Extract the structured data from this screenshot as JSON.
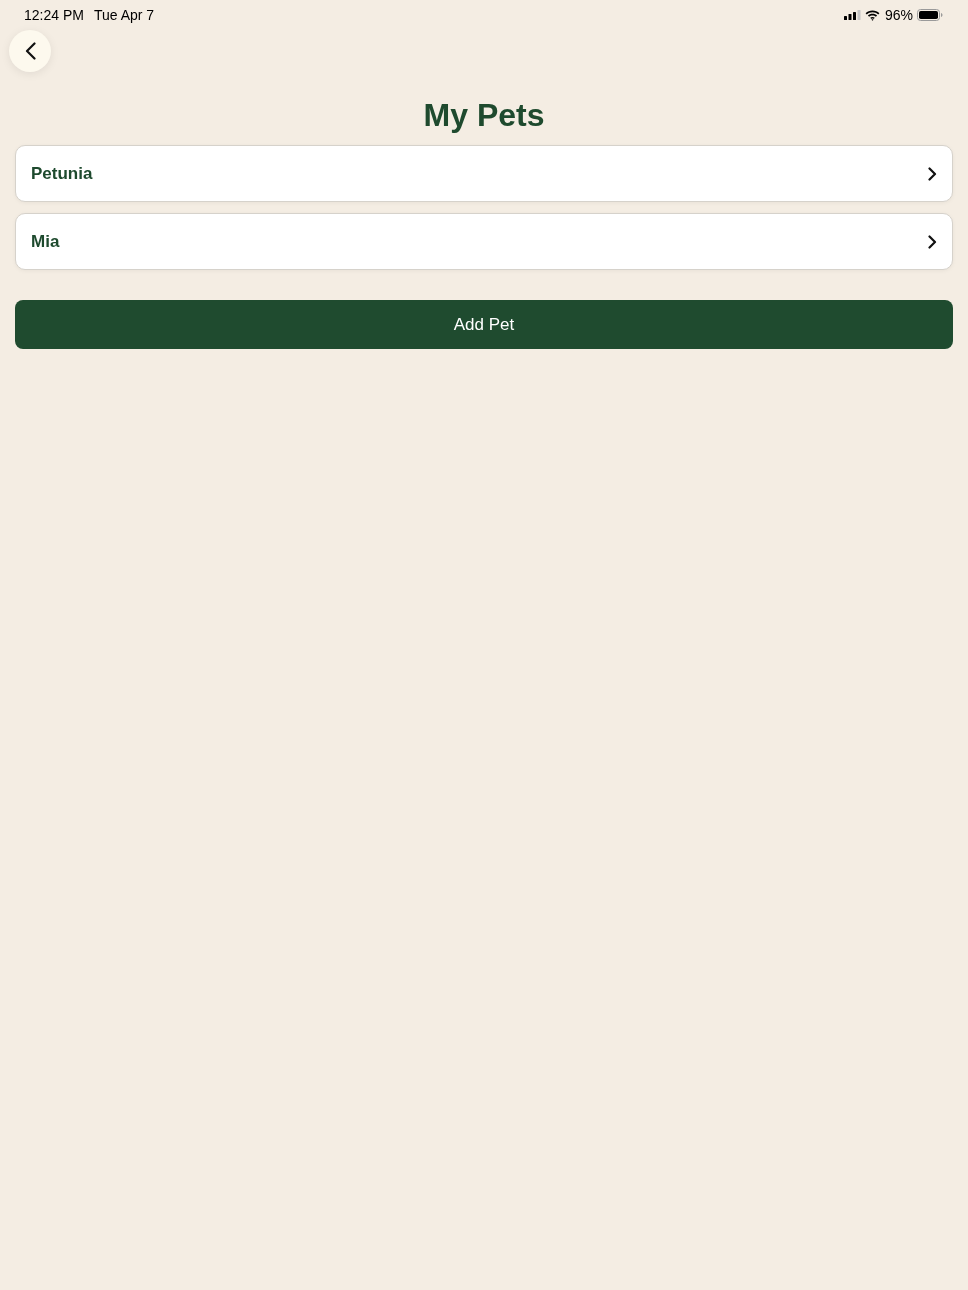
{
  "status_bar": {
    "time": "12:24 PM",
    "date": "Tue Apr 7",
    "battery": "96%"
  },
  "title": "My Pets",
  "pets": [
    {
      "name": "Petunia"
    },
    {
      "name": "Mia"
    }
  ],
  "add_button": {
    "label": "Add Pet"
  }
}
